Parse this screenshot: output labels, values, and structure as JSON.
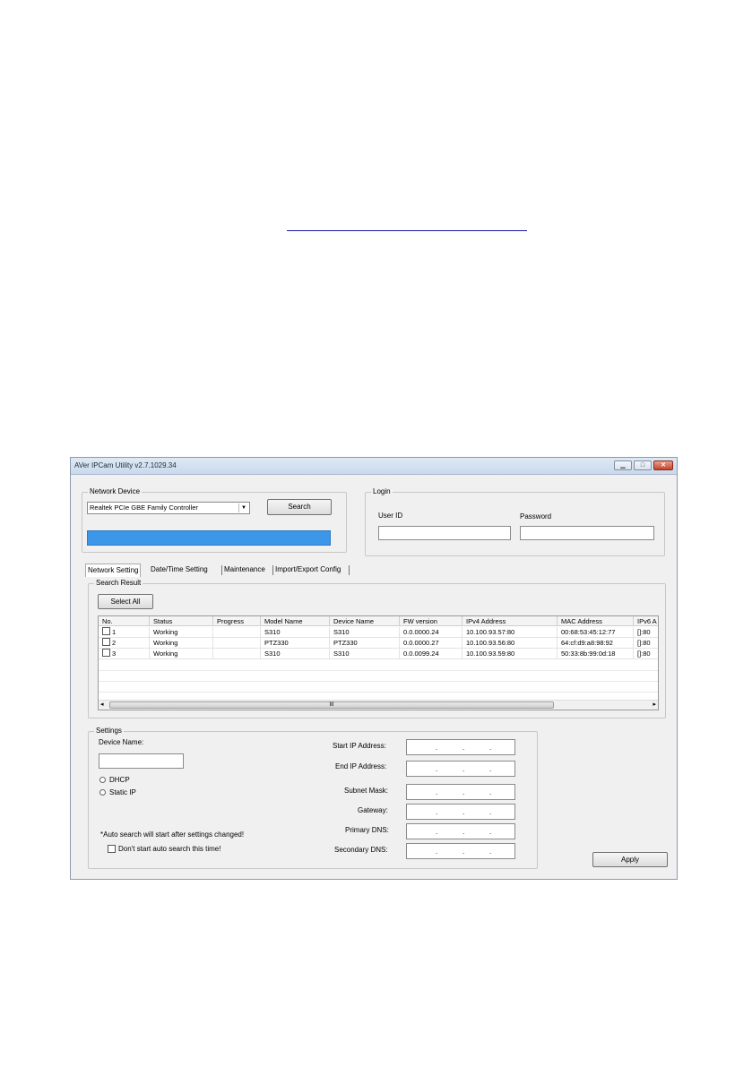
{
  "window": {
    "title": "AVer IPCam Utility v2.7.1029.34",
    "min_label": "▁",
    "max_label": "□",
    "close_label": "✕"
  },
  "network_device": {
    "legend": "Network Device",
    "adapter": "Realtek PCIe GBE Family Controller",
    "dropdown_arrow": "▼",
    "search_label": "Search",
    "progress_fraction": 1.0
  },
  "login": {
    "legend": "Login",
    "user_id_label": "User ID",
    "password_label": "Password",
    "user_id_value": "",
    "password_value": ""
  },
  "tabs": [
    "Network Setting",
    "Date/Time Setting",
    "Maintenance",
    "Import/Export Config"
  ],
  "search_result": {
    "legend": "Search Result",
    "select_all_label": "Select All",
    "columns": [
      "No.",
      "Status",
      "Progress",
      "Model Name",
      "Device Name",
      "FW version",
      "IPv4 Address",
      "MAC Address",
      "IPv6 A"
    ],
    "rows": [
      [
        "1",
        "Working",
        "",
        "S310",
        "S310",
        "0.0.0000.24",
        "10.100.93.57:80",
        "00:68:53:45:12:77",
        "[]:80"
      ],
      [
        "2",
        "Working",
        "",
        "PTZ330",
        "PTZ330",
        "0.0.0000.27",
        "10.100.93.56:80",
        "64:cf:d9:a8:98:92",
        "[]:80"
      ],
      [
        "3",
        "Working",
        "",
        "S310",
        "S310",
        "0.0.0099.24",
        "10.100.93.59:80",
        "50:33:8b:99:0d:18",
        "[]:80"
      ]
    ],
    "scroll_left": "◂",
    "scroll_right": "▸",
    "scroll_grip": "III"
  },
  "settings": {
    "legend": "Settings",
    "device_name_label": "Device Name:",
    "device_name_value": "",
    "dhcp_label": "DHCP",
    "static_ip_label": "Static IP",
    "auto_search_note": "*Auto search will start after settings changed!",
    "dont_start_label": "Don't start auto search this time!",
    "ip_fields": [
      {
        "label": "Start IP Address:"
      },
      {
        "label": "End IP Address:"
      },
      {
        "label": "Subnet Mask:"
      },
      {
        "label": "Gateway:"
      },
      {
        "label": "Primary DNS:"
      },
      {
        "label": "Secondary DNS:"
      }
    ],
    "ip_dot": ".",
    "apply_label": "Apply"
  }
}
